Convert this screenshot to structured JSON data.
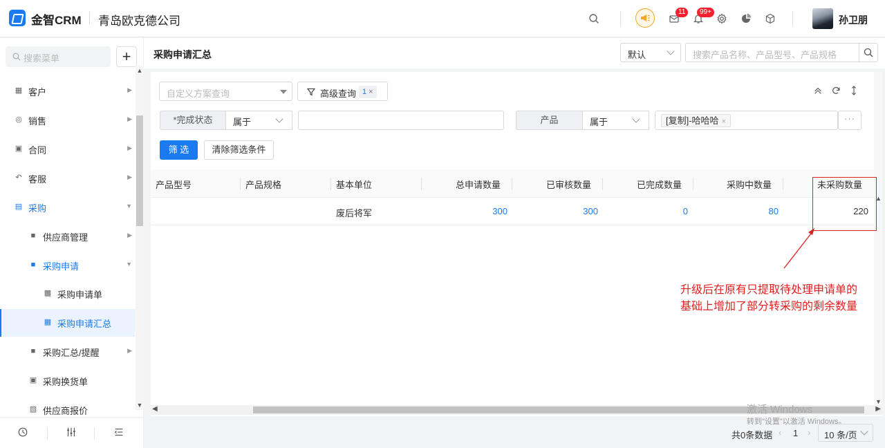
{
  "header": {
    "brand": "金智CRM",
    "company": "青岛欧克德公司",
    "mail_badge": "11",
    "bell_badge": "99+",
    "username": "孙卫朋",
    "icons": [
      "search-icon",
      "promo-icon",
      "mail-icon",
      "bell-icon",
      "gear-icon",
      "pie-chart-icon",
      "cube-icon"
    ]
  },
  "sidebar": {
    "search_placeholder": "搜索菜单",
    "add_label": "+",
    "items": [
      {
        "label": "客户",
        "icon": "customer-icon",
        "level": 1
      },
      {
        "label": "销售",
        "icon": "sales-icon",
        "level": 1
      },
      {
        "label": "合同",
        "icon": "contract-icon",
        "level": 1
      },
      {
        "label": "客服",
        "icon": "service-icon",
        "level": 1
      },
      {
        "label": "采购",
        "icon": "purchase-icon",
        "level": 1,
        "active": true,
        "expanded": true
      },
      {
        "label": "供应商管理",
        "icon": "folder-icon",
        "level": 2
      },
      {
        "label": "采购申请",
        "icon": "folder-icon",
        "level": 2,
        "active": true,
        "expanded": true
      },
      {
        "label": "采购申请单",
        "icon": "form-icon",
        "level": 3
      },
      {
        "label": "采购申请汇总",
        "icon": "summary-icon",
        "level": 3,
        "selected": true
      },
      {
        "label": "采购汇总/提醒",
        "icon": "folder-icon",
        "level": 2
      },
      {
        "label": "采购换货单",
        "icon": "exchange-icon",
        "level": 2
      },
      {
        "label": "供应商报价",
        "icon": "quote-icon",
        "level": 2
      }
    ],
    "bottom_icons": [
      "history-icon",
      "settings-sliders-icon",
      "collapse-menu-icon"
    ]
  },
  "page": {
    "title": "采购申请汇总",
    "view_select": "默认",
    "search_placeholder": "搜索产品名称、产品型号、产品规格"
  },
  "filters": {
    "scheme_placeholder": "自定义方案查询",
    "advanced_label": "高级查询",
    "advanced_count": "1",
    "row": [
      {
        "field": "*完成状态",
        "op": "属于",
        "value": ""
      },
      {
        "field": "产品",
        "op": "属于",
        "value": "[复制]-哈哈哈"
      }
    ],
    "more_label": "···",
    "filter_button": "筛 选",
    "clear_button": "清除筛选条件"
  },
  "table": {
    "columns": [
      "产品型号",
      "产品规格",
      "基本单位",
      "总申请数量",
      "已审核数量",
      "已完成数量",
      "采购中数量",
      "未采购数量"
    ],
    "rows": [
      {
        "model": "",
        "spec": "",
        "unit": "废后将军",
        "total": "300",
        "approved": "300",
        "completed": "0",
        "purchasing": "80",
        "unpurchased": "220"
      }
    ]
  },
  "annotation": {
    "line1": "升级后在原有只提取待处理申请单的",
    "line2": "基础上增加了部分转采购的剩余数量"
  },
  "watermark": {
    "title": "激活 Windows",
    "subtitle": "转到\"设置\"以激活 Windows。"
  },
  "pagination": {
    "total": "共0条数据",
    "page": "1",
    "page_size": "10 条/页"
  }
}
